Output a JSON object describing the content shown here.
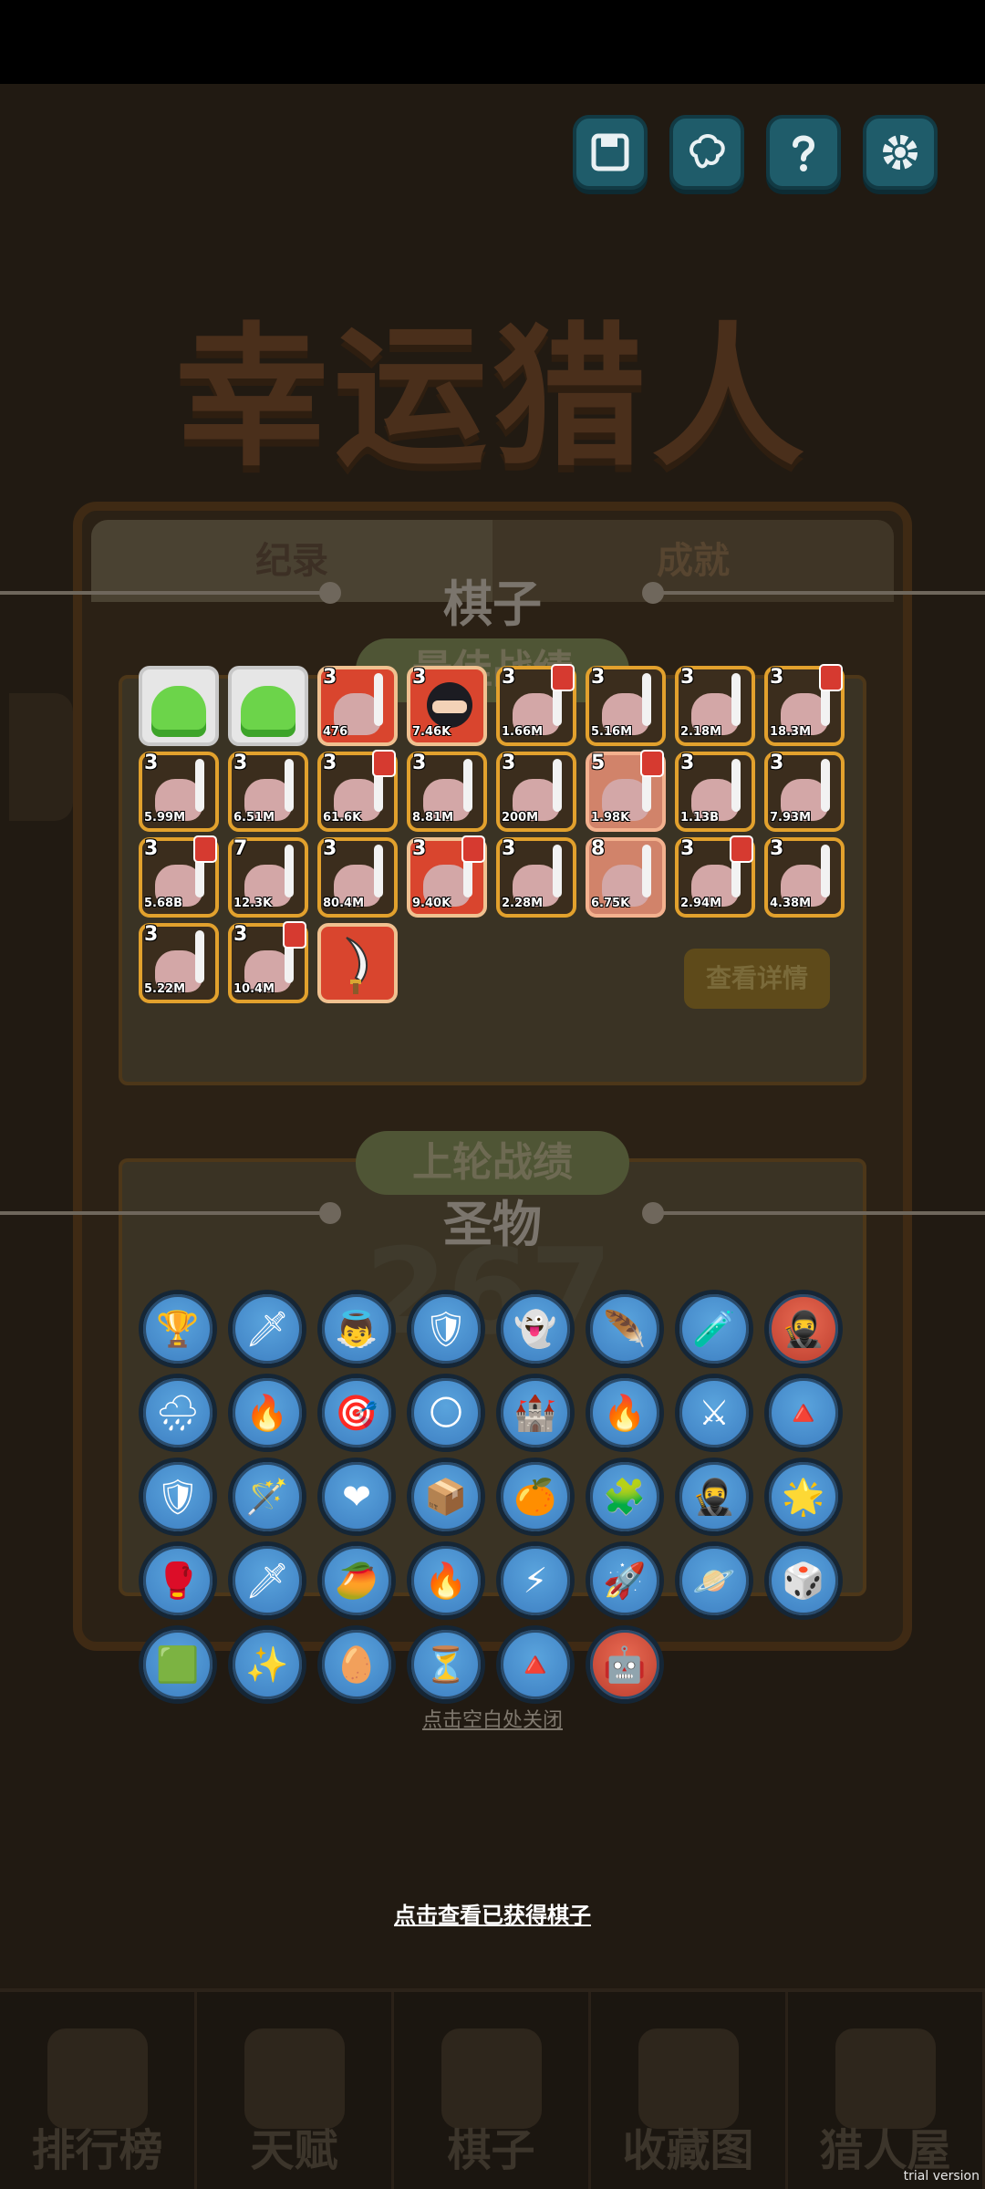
{
  "background": {
    "game_title": "幸运猎人",
    "tabs": [
      "纪录",
      "成就"
    ],
    "best_record_label": "最佳战绩",
    "last_round_label": "上轮战绩",
    "score": "267",
    "view_details": "查看详情",
    "relic_label": "圣物",
    "bottom_nav": [
      "排行榜",
      "天赋",
      "棋子",
      "收藏图",
      "猎人屋"
    ]
  },
  "top_buttons": [
    "save-icon",
    "brain-icon",
    "help-icon",
    "gear-icon"
  ],
  "pieces_section": {
    "title": "棋子",
    "pieces": [
      {
        "kind": "slime",
        "star": "",
        "count": ""
      },
      {
        "kind": "slime",
        "star": "",
        "count": ""
      },
      {
        "kind": "red",
        "star": "3",
        "count": "476"
      },
      {
        "kind": "ninja",
        "star": "3",
        "count": "7.46K"
      },
      {
        "kind": "hunter",
        "star": "3",
        "count": "1.66M"
      },
      {
        "kind": "hunter",
        "star": "3",
        "count": "5.16M"
      },
      {
        "kind": "hunter",
        "star": "3",
        "count": "2.18M"
      },
      {
        "kind": "hunter",
        "star": "3",
        "count": "18.3M"
      },
      {
        "kind": "hunter",
        "star": "3",
        "count": "5.99M"
      },
      {
        "kind": "hunter",
        "star": "3",
        "count": "6.51M"
      },
      {
        "kind": "hunter",
        "star": "3",
        "count": "61.6K"
      },
      {
        "kind": "hunter",
        "star": "3",
        "count": "8.81M"
      },
      {
        "kind": "hunter",
        "star": "3",
        "count": "200M"
      },
      {
        "kind": "pink",
        "star": "5",
        "count": "1.98K"
      },
      {
        "kind": "hunter",
        "star": "3",
        "count": "1.13B"
      },
      {
        "kind": "hunter",
        "star": "3",
        "count": "7.93M"
      },
      {
        "kind": "hunter",
        "star": "3",
        "count": "5.68B"
      },
      {
        "kind": "hunter",
        "star": "7",
        "count": "12.3K"
      },
      {
        "kind": "hunter",
        "star": "3",
        "count": "80.4M"
      },
      {
        "kind": "red",
        "star": "3",
        "count": "9.40K"
      },
      {
        "kind": "hunter",
        "star": "3",
        "count": "2.28M"
      },
      {
        "kind": "pink",
        "star": "8",
        "count": "6.75K"
      },
      {
        "kind": "hunter",
        "star": "3",
        "count": "2.94M"
      },
      {
        "kind": "hunter",
        "star": "3",
        "count": "4.38M"
      },
      {
        "kind": "hunter",
        "star": "3",
        "count": "5.22M"
      },
      {
        "kind": "hunter",
        "star": "3",
        "count": "10.4M"
      },
      {
        "kind": "sword",
        "star": "",
        "count": ""
      }
    ]
  },
  "relics_section": {
    "title": "圣物",
    "relics": [
      "🏆",
      "🗡",
      "👼",
      "🛡",
      "👻",
      "🪶",
      "🧪",
      "🥷",
      "🌧",
      "🔥",
      "🎯",
      "🌕",
      "🏰",
      "🔥",
      "⚔",
      "🔺",
      "🛡",
      "🪄",
      "❤",
      "📦",
      "🍊",
      "🧩",
      "🥷",
      "🌟",
      "🥊",
      "🗡",
      "🥭",
      "🔥",
      "⚡",
      "🚀",
      "🪐",
      "🎲",
      "🟩",
      "✨",
      "🥚",
      "⏳",
      "🔺",
      "🤖"
    ]
  },
  "close_hint": "点击空白处关闭",
  "view_hint": "点击查看已获得棋子",
  "watermark": "trial version"
}
